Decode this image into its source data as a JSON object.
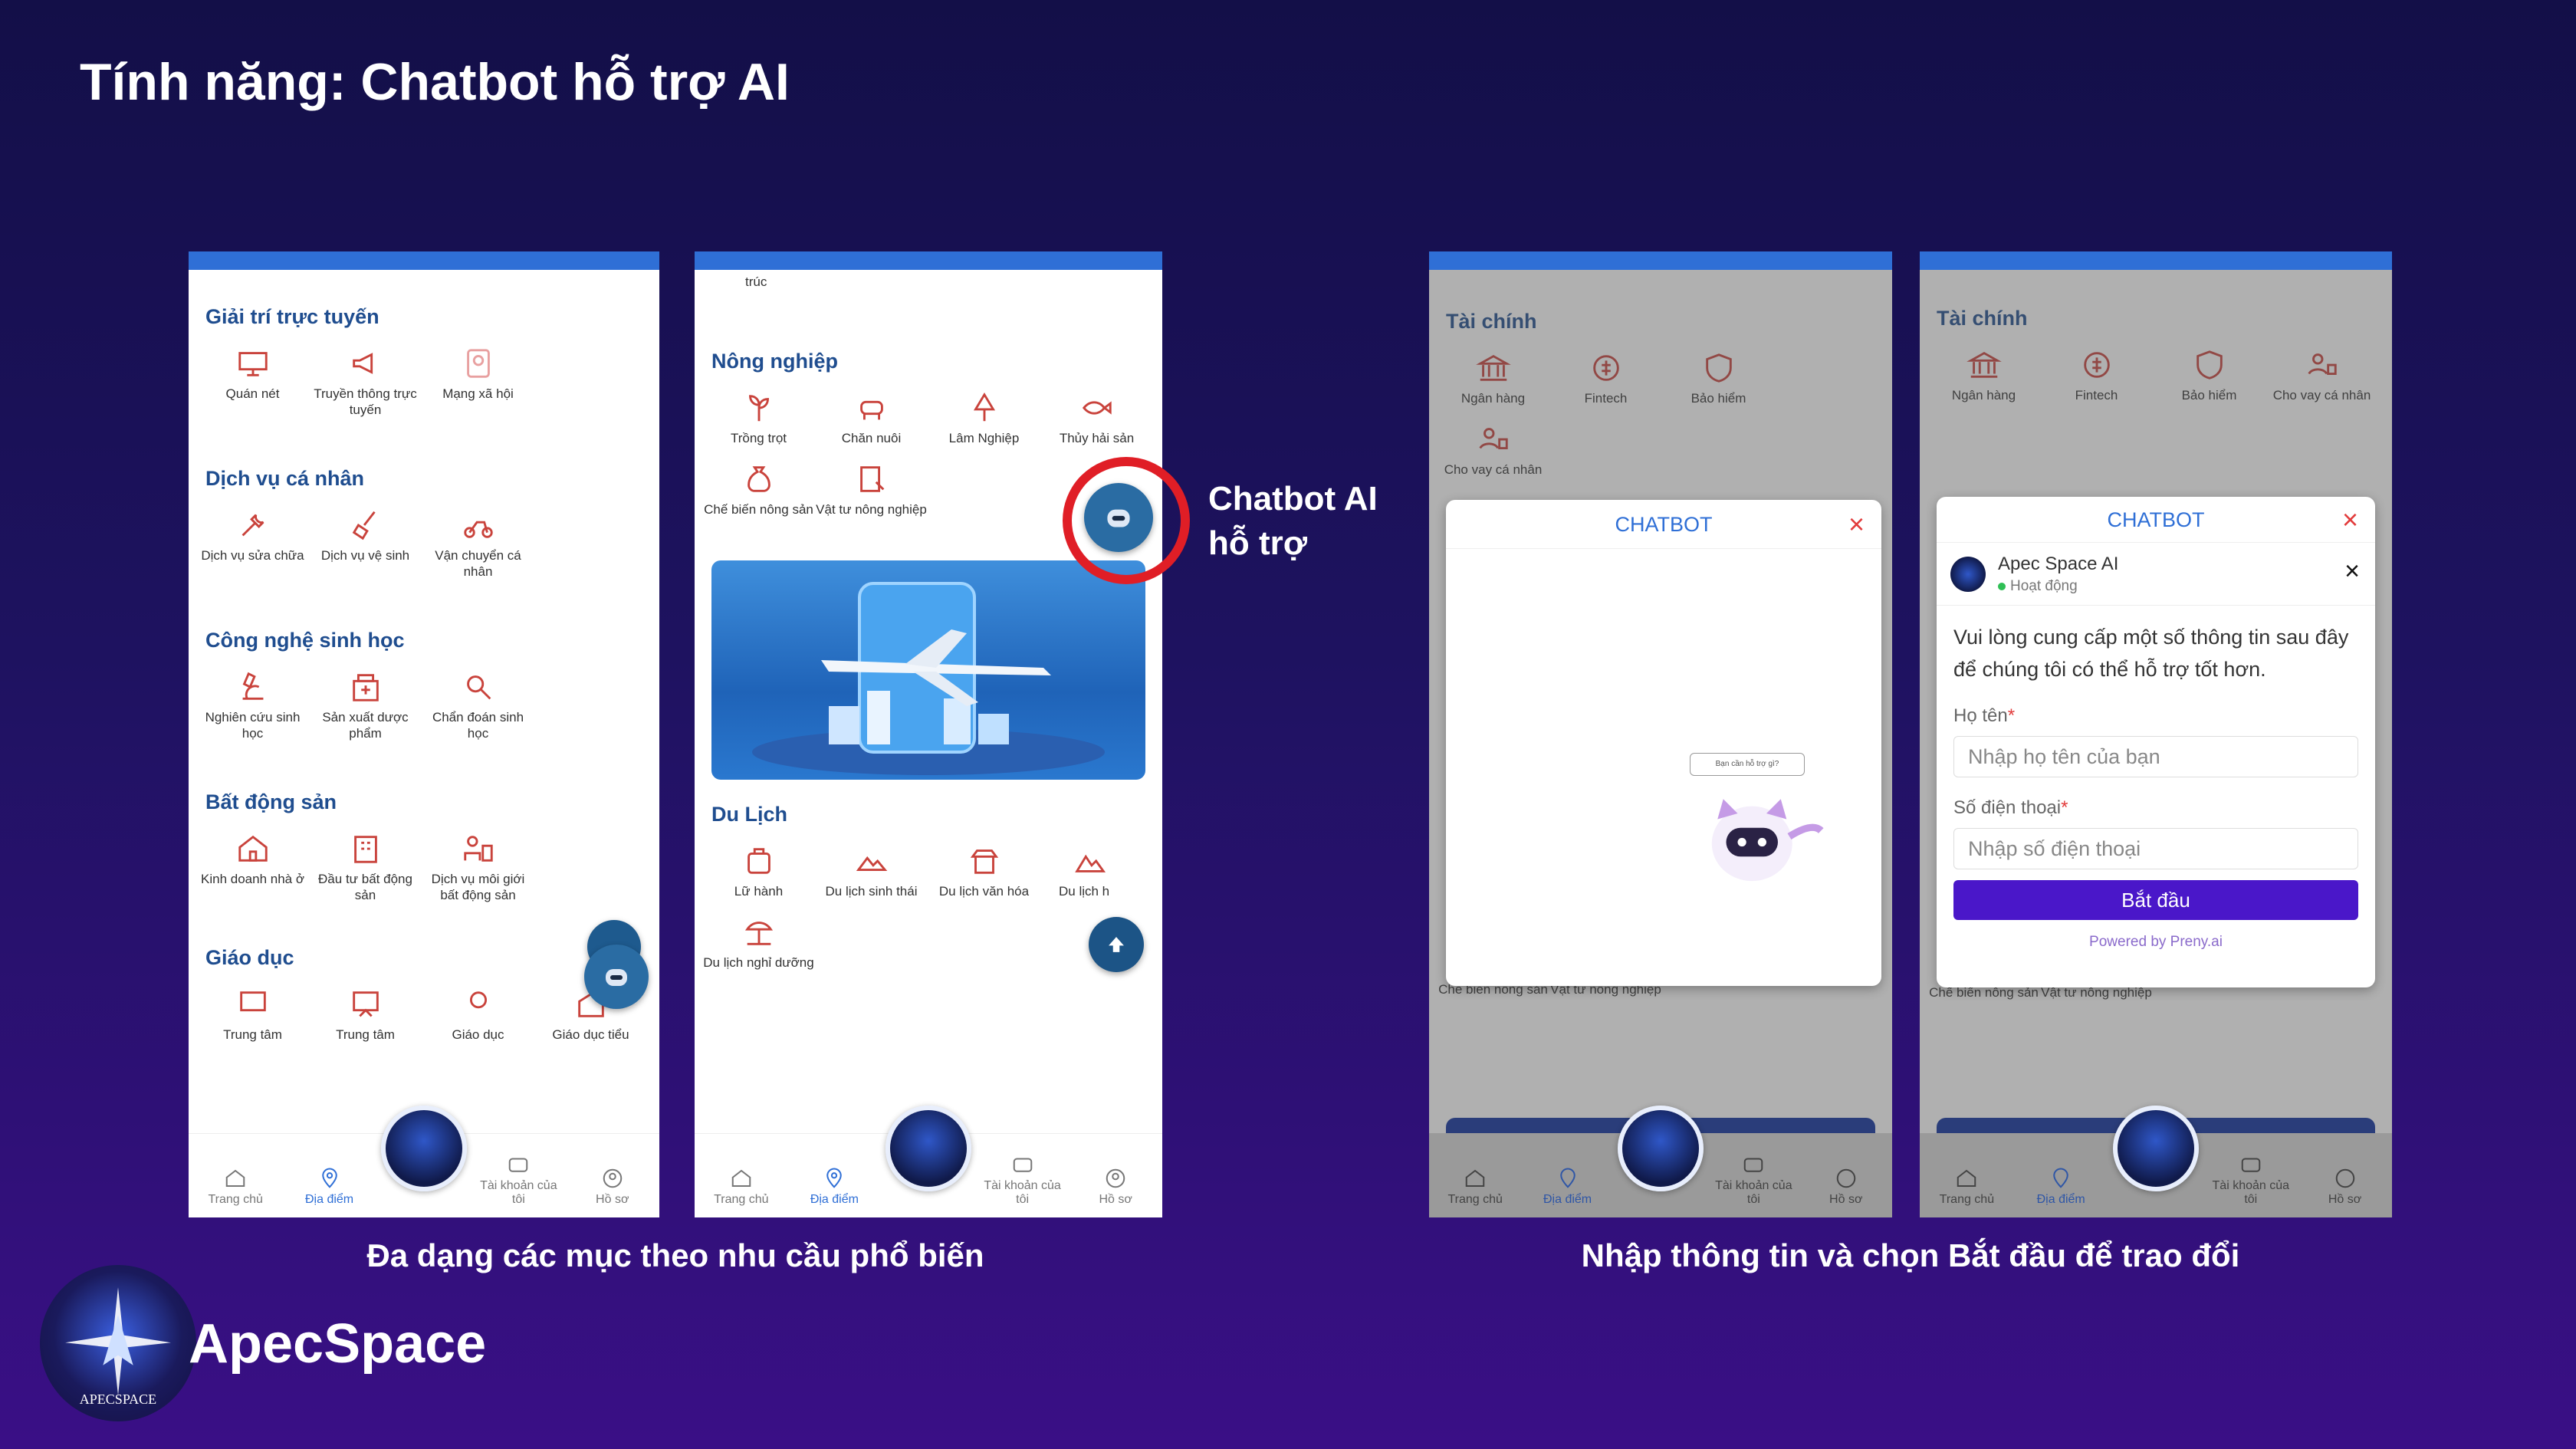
{
  "slide": {
    "title": "Tính năng: Chatbot hỗ trợ AI",
    "caption_left": "Đa dạng các mục theo nhu cầu phổ biến",
    "caption_right": "Nhập thông tin và chọn Bắt đầu để trao đổi",
    "callout_line1": "Chatbot AI",
    "callout_line2": "hỗ trợ",
    "brand": "ApecSpace",
    "logo_subtext": "APECSPACE"
  },
  "phone1": {
    "sections": [
      {
        "title": "Giải trí trực tuyến",
        "items": [
          "Quán nét",
          "Truyền thông trực tuyến",
          "Mạng xã hội"
        ]
      },
      {
        "title": "Dịch vụ cá nhân",
        "items": [
          "Dịch vụ sửa chữa",
          "Dịch vụ vệ sinh",
          "Vận chuyển cá nhân"
        ]
      },
      {
        "title": "Công nghệ sinh học",
        "items": [
          "Nghiên cứu sinh học",
          "Sản xuất dược phẩm",
          "Chẩn đoán sinh học"
        ]
      },
      {
        "title": "Bất động sản",
        "items": [
          "Kinh doanh nhà ở",
          "Đầu tư bất động sản",
          "Dịch vụ môi giới bất động sản"
        ]
      },
      {
        "title": "Giáo dục",
        "items": [
          "Trung tâm",
          "Trung tâm",
          "Giáo dục",
          "Giáo dục tiểu"
        ]
      }
    ]
  },
  "phone2": {
    "top_fragment": "trúc",
    "sections": [
      {
        "title": "Nông nghiệp",
        "items": [
          "Trồng trọt",
          "Chăn nuôi",
          "Lâm Nghiệp",
          "Thủy hải sản",
          "Chế biến nông sản",
          "Vật tư nông nghiệp"
        ]
      },
      {
        "title": "Du Lịch",
        "items": [
          "Lữ hành",
          "Du lịch sinh thái",
          "Du lịch văn hóa",
          "Du lịch h",
          "Du lịch nghỉ dưỡng"
        ]
      }
    ]
  },
  "phone3": {
    "section_title": "Tài chính",
    "items": [
      "Ngân hàng",
      "Fintech",
      "Bảo hiểm",
      "Cho vay cá nhân"
    ],
    "bottom_items": [
      "Chế biến nông sản",
      "Vật tư nông nghiệp"
    ],
    "chatbot_title": "CHATBOT",
    "bubble_text": "Bạn cần hỗ trợ gì?"
  },
  "phone4": {
    "section_title": "Tài chính",
    "items": [
      "Ngân hàng",
      "Fintech",
      "Bảo hiểm",
      "Cho vay cá nhân"
    ],
    "bottom_items": [
      "Chế biến nông sản",
      "Vật tư nông nghiệp"
    ],
    "chatbot_title": "CHATBOT",
    "agent_name": "Apec Space AI",
    "agent_status": "Hoạt động",
    "intro": "Vui lòng cung cấp một số thông tin sau đây để chúng tôi có thể hỗ trợ tốt hơn.",
    "name_label": "Họ tên",
    "name_placeholder": "Nhập họ tên của bạn",
    "phone_label": "Số điện thoại",
    "phone_placeholder": "Nhập số điện thoại",
    "start_button": "Bắt đầu",
    "powered": "Powered by Preny.ai"
  },
  "nav": {
    "home": "Trang chủ",
    "places": "Địa điểm",
    "account": "Tài khoản của tôi",
    "profile": "Hồ sơ"
  },
  "colors": {
    "accent": "#2f6fd6",
    "icon_red": "#c9433c",
    "start_button": "#4a17c9",
    "callout_ring": "#e01e26"
  }
}
